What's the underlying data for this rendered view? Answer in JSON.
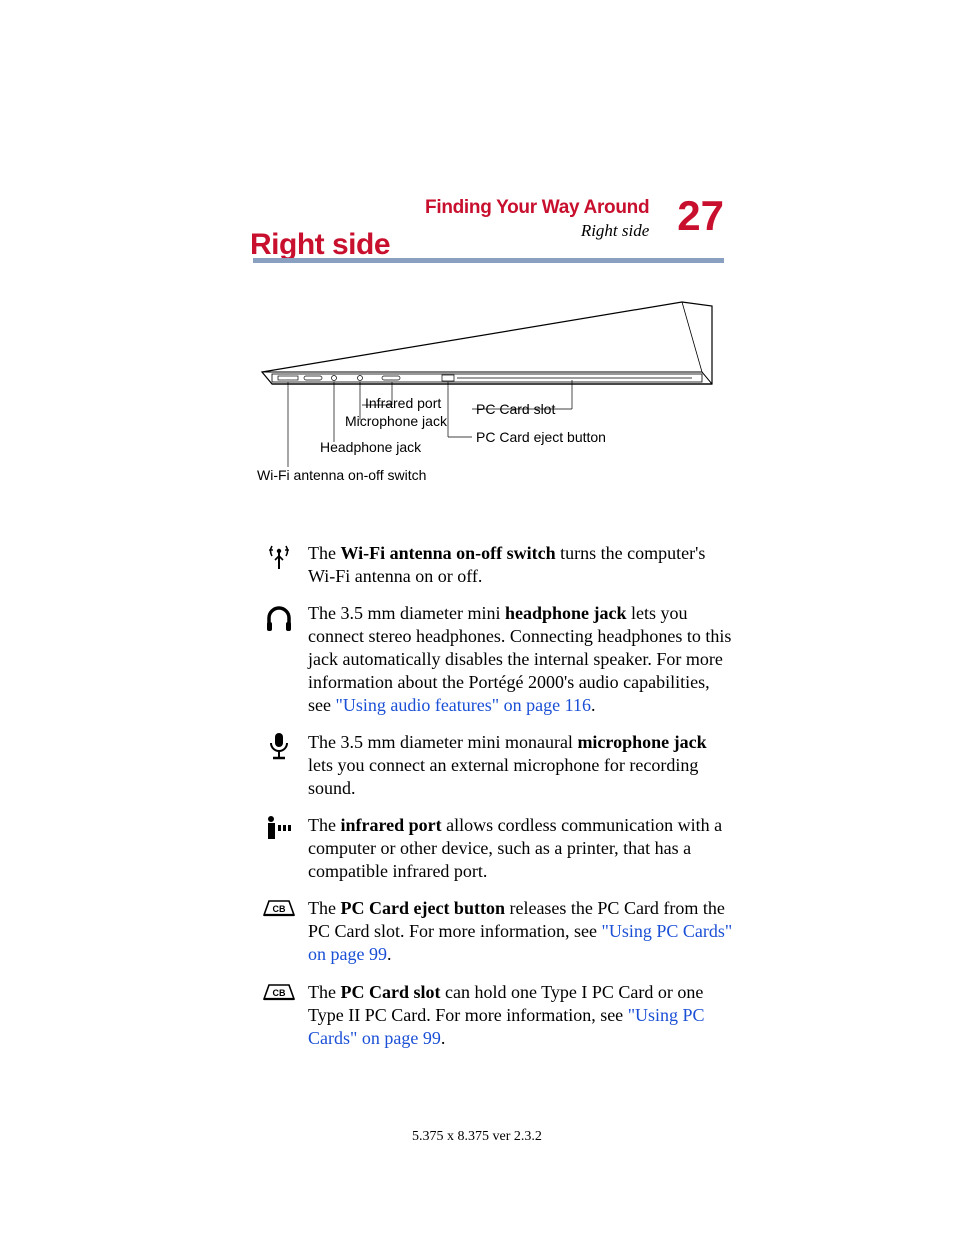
{
  "header": {
    "chapter": "Finding Your Way Around",
    "section": "Right side",
    "page_number": "27"
  },
  "heading": "Right side",
  "diagram_labels": {
    "infrared": "Infrared port",
    "microphone": "Microphone jack",
    "headphone": "Headphone jack",
    "wifi": "Wi-Fi antenna on-off switch",
    "pc_slot": "PC Card slot",
    "pc_eject": "PC Card eject button"
  },
  "items": {
    "wifi": {
      "pre": "The ",
      "bold": "Wi-Fi antenna on-off switch",
      "post": " turns the computer's Wi-Fi antenna on or off."
    },
    "headphone": {
      "pre": "The 3.5 mm diameter mini ",
      "bold": "headphone jack",
      "post1": " lets you connect stereo headphones. Connecting headphones to this jack automatically disables the internal speaker. For more information about the Portégé 2000's audio capabilities, see ",
      "link": "\"Using audio features\" on page 116",
      "post2": "."
    },
    "microphone": {
      "pre": "The 3.5 mm diameter mini monaural ",
      "bold": "microphone jack",
      "post": " lets you connect an external microphone for recording sound."
    },
    "infrared": {
      "pre": "The ",
      "bold": "infrared port",
      "post": " allows cordless communication with a computer or other device, such as a printer, that has a compatible infrared port."
    },
    "pc_eject": {
      "pre": "The ",
      "bold": "PC Card eject button",
      "post1": " releases the PC Card from the PC Card slot. For more information, see ",
      "link": "\"Using PC Cards\" on page 99",
      "post2": "."
    },
    "pc_slot": {
      "pre": "The ",
      "bold": "PC Card slot",
      "post1": " can hold one Type I PC Card or one Type II PC Card. For more information, see ",
      "link": "\"Using PC Cards\" on page 99",
      "post2": "."
    }
  },
  "footer": "5.375 x 8.375 ver 2.3.2"
}
